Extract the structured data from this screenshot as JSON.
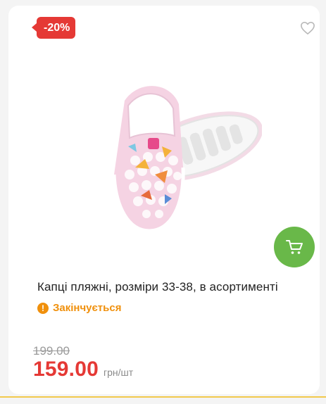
{
  "badge": {
    "discount": "-20%"
  },
  "product": {
    "title": "Капці пляжні, розміри 33-38, в асортименті",
    "stock_status": "Закінчується",
    "stock_icon_symbol": "!",
    "old_price": "199.00",
    "price": "159.00",
    "unit": "грн/шт"
  },
  "icons": {
    "favorite": "heart-outline-icon",
    "cart": "shopping-cart-icon",
    "stock": "warning-circle-icon"
  },
  "colors": {
    "discount_badge": "#e53935",
    "price": "#e53935",
    "cart_button": "#69b849",
    "stock_warning": "#f0900c"
  }
}
